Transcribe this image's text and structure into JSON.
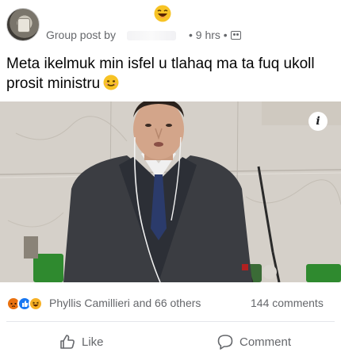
{
  "header": {
    "meta_prefix": "Group post by",
    "time_text": "• 9 hrs •",
    "title_emoji": "laughing-face"
  },
  "post": {
    "text": "Meta ikelmuk min isfel u tlahaq ma ta fuq ukoll prosit ministru",
    "emoji": "smiling-face"
  },
  "photo": {
    "info_label": "i"
  },
  "reactions": {
    "icons": [
      "angry-react",
      "like-react",
      "haha-react"
    ],
    "names_text": "Phyllis Camillieri and 66 others",
    "comments_text": "144 comments"
  },
  "actions": {
    "like_label": "Like",
    "comment_label": "Comment"
  },
  "colors": {
    "meta": "#65676b",
    "text": "#050505",
    "divider": "#e4e6eb",
    "like_blue": "#1877f2"
  }
}
